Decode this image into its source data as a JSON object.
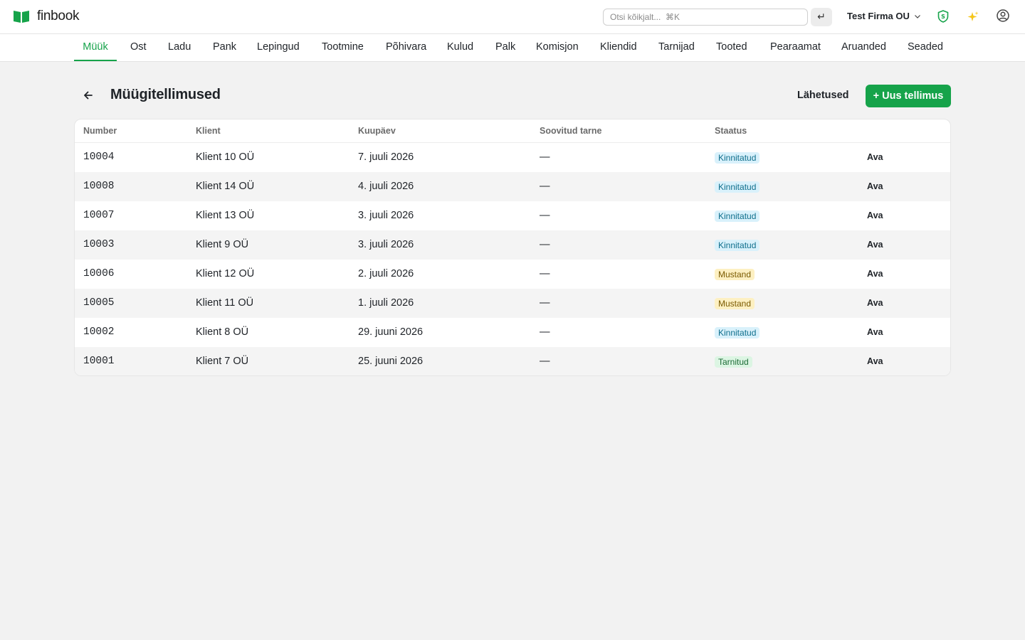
{
  "app": {
    "name": "finbook"
  },
  "search": {
    "placeholder": "Otsi kõikjalt...  ⌘K",
    "enter_label": "↵"
  },
  "company": {
    "name": "Test Firma OU"
  },
  "nav": {
    "items": [
      {
        "label": "Müük",
        "active": true
      },
      {
        "label": "Ost"
      },
      {
        "label": "Ladu"
      },
      {
        "label": "Pank"
      },
      {
        "label": "Lepingud"
      },
      {
        "label": "Tootmine"
      },
      {
        "label": "Põhivara"
      },
      {
        "label": "Kulud"
      },
      {
        "label": "Palk"
      },
      {
        "label": "Komisjon"
      },
      {
        "label": "Kliendid"
      },
      {
        "label": "Tarnijad"
      },
      {
        "label": "Tooted"
      },
      {
        "label": "Pearaamat"
      },
      {
        "label": "Aruanded"
      },
      {
        "label": "Seaded"
      }
    ]
  },
  "page": {
    "title": "Müügitellimused",
    "secondary_action": "Lähetused",
    "primary_action": "+ Uus tellimus"
  },
  "table": {
    "columns": [
      "Number",
      "Klient",
      "Kuupäev",
      "Soovitud tarne",
      "Staatus"
    ],
    "open_label": "Ava",
    "rows": [
      {
        "number": "10004",
        "client": "Klient 10 OÜ",
        "date": "7. juuli 2026",
        "delivery": "—",
        "status": "Kinnitatud",
        "status_type": "kinnitatud"
      },
      {
        "number": "10008",
        "client": "Klient 14 OÜ",
        "date": "4. juuli 2026",
        "delivery": "—",
        "status": "Kinnitatud",
        "status_type": "kinnitatud"
      },
      {
        "number": "10007",
        "client": "Klient 13 OÜ",
        "date": "3. juuli 2026",
        "delivery": "—",
        "status": "Kinnitatud",
        "status_type": "kinnitatud"
      },
      {
        "number": "10003",
        "client": "Klient 9 OÜ",
        "date": "3. juuli 2026",
        "delivery": "—",
        "status": "Kinnitatud",
        "status_type": "kinnitatud"
      },
      {
        "number": "10006",
        "client": "Klient 12 OÜ",
        "date": "2. juuli 2026",
        "delivery": "—",
        "status": "Mustand",
        "status_type": "mustand"
      },
      {
        "number": "10005",
        "client": "Klient 11 OÜ",
        "date": "1. juuli 2026",
        "delivery": "—",
        "status": "Mustand",
        "status_type": "mustand"
      },
      {
        "number": "10002",
        "client": "Klient 8 OÜ",
        "date": "29. juuni 2026",
        "delivery": "—",
        "status": "Kinnitatud",
        "status_type": "kinnitatud"
      },
      {
        "number": "10001",
        "client": "Klient 7 OÜ",
        "date": "25. juuni 2026",
        "delivery": "—",
        "status": "Tarnitud",
        "status_type": "tarnitud"
      }
    ]
  },
  "colors": {
    "accent": "#16a34a",
    "badge_kinnitatud": "#d9f1fb",
    "badge_mustand": "#fdf0c2",
    "badge_tarnitud": "#dcf5e3"
  },
  "icons": {
    "logo": "book-icon",
    "shield": "shield-s-icon",
    "sparkle": "sparkle-icon",
    "user": "user-circle-icon",
    "back": "arrow-left-icon",
    "company_dropdown": "chevron-down-icon"
  }
}
